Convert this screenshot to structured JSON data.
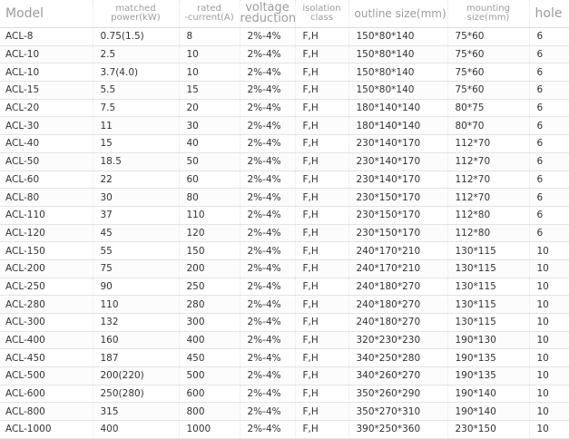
{
  "table": {
    "headers": [
      {
        "lines": [
          "Model"
        ]
      },
      {
        "lines": [
          "matched",
          "power(kW)"
        ]
      },
      {
        "lines": [
          "rated",
          "-current(A)"
        ]
      },
      {
        "lines": [
          "voltage",
          "reduction"
        ]
      },
      {
        "lines": [
          "isolation",
          "class"
        ]
      },
      {
        "lines": [
          "outline size(mm)"
        ]
      },
      {
        "lines": [
          "mounting",
          "size(mm)"
        ]
      },
      {
        "lines": [
          "hole"
        ]
      }
    ],
    "rows": [
      [
        "ACL-8",
        "0.75(1.5)",
        "8",
        "2%-4%",
        "F,H",
        "150*80*140",
        "75*60",
        "6"
      ],
      [
        "ACL-10",
        "2.5",
        "10",
        "2%-4%",
        "F,H",
        "150*80*140",
        "75*60",
        "6"
      ],
      [
        "ACL-10",
        "3.7(4.0)",
        "10",
        "2%-4%",
        "F,H",
        "150*80*140",
        "75*60",
        "6"
      ],
      [
        "ACL-15",
        "5.5",
        "15",
        "2%-4%",
        "F,H",
        "150*80*140",
        "75*60",
        "6"
      ],
      [
        "ACL-20",
        "7.5",
        "20",
        "2%-4%",
        "F,H",
        "180*140*140",
        "80*75",
        "6"
      ],
      [
        "ACL-30",
        "11",
        "30",
        "2%-4%",
        "F,H",
        "180*140*140",
        "80*70",
        "6"
      ],
      [
        "ACL-40",
        "15",
        "40",
        "2%-4%",
        "F,H",
        "230*140*170",
        "112*70",
        "6"
      ],
      [
        "ACL-50",
        "18.5",
        "50",
        "2%-4%",
        "F,H",
        "230*140*170",
        "112*70",
        "6"
      ],
      [
        "ACL-60",
        "22",
        "60",
        "2%-4%",
        "F,H",
        "230*140*170",
        "112*70",
        "6"
      ],
      [
        "ACL-80",
        "30",
        "80",
        "2%-4%",
        "F,H",
        "230*150*170",
        "112*70",
        "6"
      ],
      [
        "ACL-110",
        "37",
        "110",
        "2%-4%",
        "F,H",
        "230*150*170",
        "112*80",
        "6"
      ],
      [
        "ACL-120",
        "45",
        "120",
        "2%-4%",
        "F,H",
        "230*150*170",
        "112*80",
        "6"
      ],
      [
        "ACL-150",
        "55",
        "150",
        "2%-4%",
        "F,H",
        "240*170*210",
        "130*115",
        "10"
      ],
      [
        "ACL-200",
        "75",
        "200",
        "2%-4%",
        "F,H",
        "240*170*210",
        "130*115",
        "10"
      ],
      [
        "ACL-250",
        "90",
        "250",
        "2%-4%",
        "F,H",
        "240*180*270",
        "130*115",
        "10"
      ],
      [
        "ACL-280",
        "110",
        "280",
        "2%-4%",
        "F,H",
        "240*180*270",
        "130*115",
        "10"
      ],
      [
        "ACL-300",
        "132",
        "300",
        "2%-4%",
        "F,H",
        "240*180*270",
        "130*115",
        "10"
      ],
      [
        "ACL-400",
        "160",
        "400",
        "2%-4%",
        "F,H",
        "320*230*230",
        "190*130",
        "10"
      ],
      [
        "ACL-450",
        "187",
        "450",
        "2%-4%",
        "F,H",
        "340*250*280",
        "190*135",
        "10"
      ],
      [
        "ACL-500",
        "200(220)",
        "500",
        "2%-4%",
        "F,H",
        "340*260*270",
        "190*135",
        "10"
      ],
      [
        "ACL-600",
        "250(280)",
        "600",
        "2%-4%",
        "F,H",
        "350*260*290",
        "190*140",
        "10"
      ],
      [
        "ACL-800",
        "315",
        "800",
        "2%-4%",
        "F,H",
        "350*270*310",
        "190*140",
        "10"
      ],
      [
        "ACL-1000",
        "400",
        "1000",
        "2%-4%",
        "F,H",
        "390*250*360",
        "230*150",
        "10"
      ]
    ]
  },
  "colors": {
    "header_text": "#9c9c9c",
    "cell_text": "#333333",
    "row_border": "#e4e4e4"
  }
}
